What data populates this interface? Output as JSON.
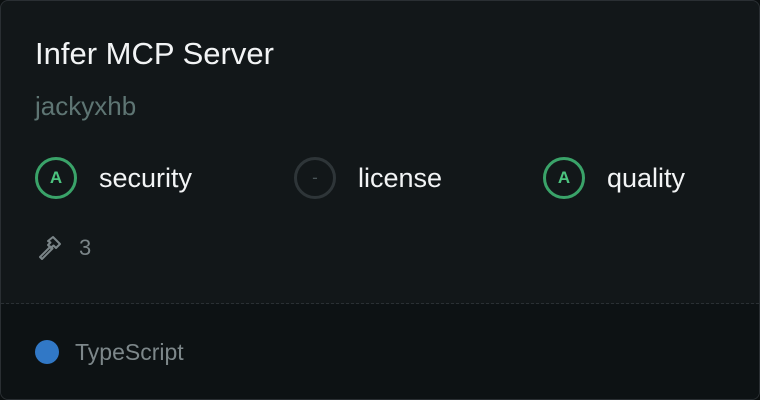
{
  "server": {
    "title": "Infer MCP Server",
    "author": "jackyxhb"
  },
  "scores": [
    {
      "grade": "A",
      "label": "security",
      "status_color": "#3aa369"
    },
    {
      "grade": "-",
      "label": "license",
      "status_color": "#2e3538"
    },
    {
      "grade": "A",
      "label": "quality",
      "status_color": "#3aa369"
    }
  ],
  "tools": {
    "icon": "hammer-icon",
    "count": "3"
  },
  "language": {
    "name": "TypeScript",
    "color": "#3178c6"
  }
}
